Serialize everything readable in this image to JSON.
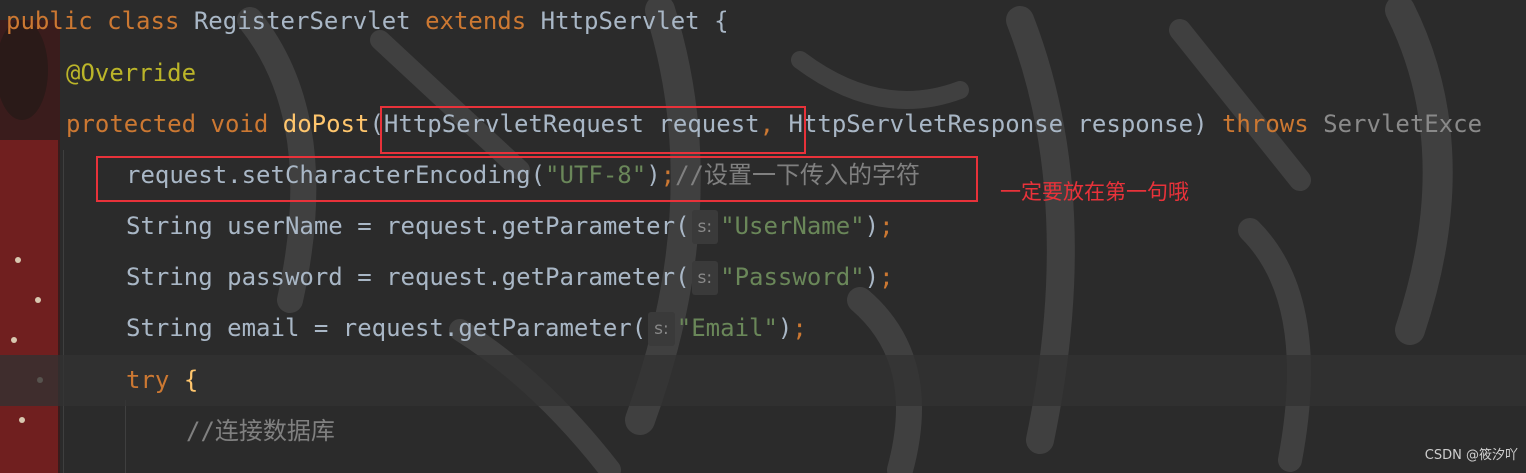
{
  "code": {
    "l1": {
      "public": "public",
      "class": "class",
      "name": "RegisterServlet",
      "extends": "extends",
      "parent": "HttpServlet",
      "brace": "{"
    },
    "l2": {
      "annotation": "@Override"
    },
    "l3": {
      "protected": "protected",
      "void": "void",
      "method": "doPost",
      "paren_open": "(",
      "param1": "HttpServletRequest request",
      "comma": ",",
      "param2": "HttpServletResponse response",
      "paren_close": ")",
      "throws": "throws",
      "exc": "ServletExce"
    },
    "l4": {
      "call": "request.setCharacterEncoding(",
      "arg": "\"UTF-8\"",
      "close": ")",
      "semi": ";",
      "comment": "//设置一下传入的字符"
    },
    "l5": {
      "decl": "String userName = request.getParameter(",
      "hint": "s:",
      "arg": "\"UserName\"",
      "close": ")",
      "semi": ";"
    },
    "l6": {
      "decl": "String password = request.getParameter(",
      "hint": "s:",
      "arg": "\"Password\"",
      "close": ")",
      "semi": ";"
    },
    "l7": {
      "decl": "String email = request.getParameter(",
      "hint": "s:",
      "arg": "\"Email\"",
      "close": ")",
      "semi": ";"
    },
    "l8": {
      "try": "try",
      "brace": "{"
    },
    "l9": {
      "comment": "//连接数据库"
    }
  },
  "annotation_note": "一定要放在第一句哦",
  "watermark": "CSDN @筱汐吖",
  "colors": {
    "background": "#2b2b2b",
    "keyword": "#cc7832",
    "annotation": "#bbb529",
    "method": "#ffc66d",
    "string": "#6a8759",
    "comment": "#808080",
    "highlight_box": "#e8323a"
  }
}
